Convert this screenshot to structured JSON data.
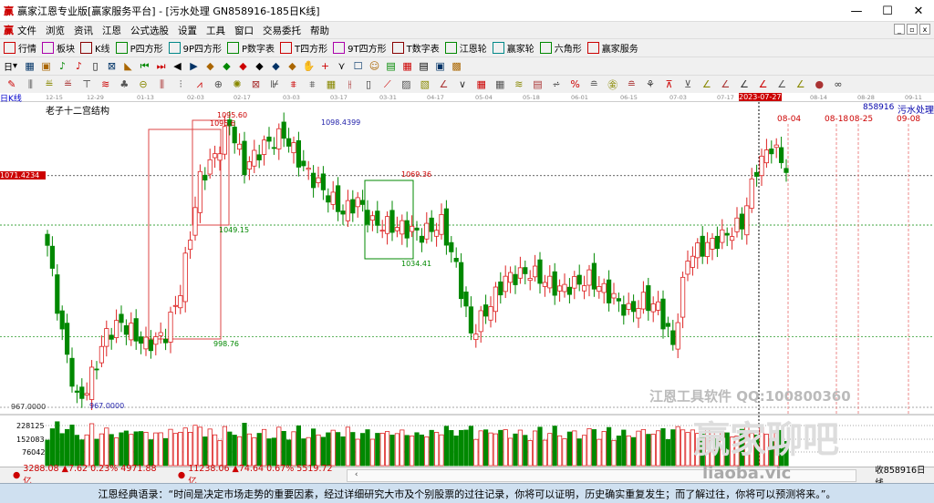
{
  "window": {
    "logo": "赢",
    "title": "赢家江恩专业版[赢家服务平台] - [污水处理  GN858916-185日K线]",
    "min": "—",
    "max": "☐",
    "close": "✕"
  },
  "menu": [
    "文件",
    "浏览",
    "资讯",
    "江恩",
    "公式选股",
    "设置",
    "工具",
    "窗口",
    "交易委托",
    "帮助"
  ],
  "toolbar1": [
    {
      "label": "行情",
      "icon": "grid-icon"
    },
    {
      "label": "板块",
      "icon": "blocks-icon"
    },
    {
      "label": "K线",
      "icon": "kline-icon"
    },
    {
      "label": "P四方形",
      "icon": "P5"
    },
    {
      "label": "9P四方形",
      "icon": "P9"
    },
    {
      "label": "P数字表",
      "icon": "PN"
    },
    {
      "label": "T四方形",
      "icon": "T5"
    },
    {
      "label": "9T四方形",
      "icon": "T9"
    },
    {
      "label": "T数字表",
      "icon": "TN"
    },
    {
      "label": "江恩轮",
      "icon": "wheel-icon"
    },
    {
      "label": "赢家轮",
      "icon": "wheel-icon"
    },
    {
      "label": "六角形",
      "icon": "hexagon-icon"
    },
    {
      "label": "赢家服务",
      "icon": "service-icon"
    }
  ],
  "toolbar2": {
    "period": "日"
  },
  "period_label": "日K线",
  "dates": [
    "12-15",
    "12-29",
    "01-13",
    "02-03",
    "02-17",
    "03-03",
    "03-17",
    "03-31",
    "04-17",
    "05-04",
    "05-18",
    "06-01",
    "06-15",
    "07-03",
    "07-17",
    "2023-07-27",
    "08-14",
    "08-28",
    "09-11"
  ],
  "chart": {
    "title": "老子十二宫结构",
    "stock": "858916",
    "name": "污水处理",
    "price_line": "1071.4234",
    "min_axis": "967.0000",
    "annotations": {
      "high": "1095.60",
      "high2": "1098.4399",
      "low": "967.0000",
      "h1": "1095.6",
      "l1": "1049.15",
      "l2": "998.76",
      "l3": "1034.41",
      "mid": "1069.36"
    },
    "future_dates": [
      "08-04",
      "08-18",
      "08-25",
      "09-08"
    ],
    "volume_ticks": [
      "228125",
      "152083",
      "76042"
    ],
    "watermark1": "江恩工具软件  QQ:100800360",
    "watermark2": "赢家聊吧",
    "watermark3": "liaoba.vic"
  },
  "chart_data": {
    "type": "candlestick",
    "ylim": [
      967,
      1098.44
    ],
    "close_keypoints": [
      [
        0,
        1040
      ],
      [
        3,
        1000
      ],
      [
        6,
        970
      ],
      [
        8,
        975
      ],
      [
        12,
        1000
      ],
      [
        15,
        1005
      ],
      [
        20,
        995
      ],
      [
        24,
        1000
      ],
      [
        27,
        1020
      ],
      [
        31,
        1070
      ],
      [
        34,
        1080
      ],
      [
        37,
        1095
      ],
      [
        40,
        1075
      ],
      [
        44,
        1085
      ],
      [
        48,
        1090
      ],
      [
        52,
        1075
      ],
      [
        56,
        1065
      ],
      [
        60,
        1055
      ],
      [
        63,
        1060
      ],
      [
        66,
        1050
      ],
      [
        72,
        1048
      ],
      [
        76,
        1045
      ],
      [
        80,
        1050
      ],
      [
        83,
        1030
      ],
      [
        86,
        1000
      ],
      [
        89,
        1010
      ],
      [
        93,
        1025
      ],
      [
        98,
        1028
      ],
      [
        104,
        1020
      ],
      [
        110,
        1025
      ],
      [
        114,
        1018
      ],
      [
        118,
        1010
      ],
      [
        121,
        1015
      ],
      [
        124,
        1012
      ],
      [
        127,
        995
      ],
      [
        130,
        1035
      ],
      [
        134,
        1040
      ],
      [
        138,
        1045
      ],
      [
        141,
        1050
      ],
      [
        144,
        1075
      ],
      [
        147,
        1085
      ],
      [
        150,
        1075
      ]
    ],
    "volume_range": [
      0,
      300000
    ]
  },
  "status": {
    "sh": "3288.08 ▲7.62 0.23% 4971.88亿",
    "sz": "11238.06 ▲74.64 0.67% 5519.72亿",
    "right": "收858916日线"
  },
  "quote": "江恩经典语录：“时间是决定市场走势的重要因素，经过详细研究大市及个别股票的过往记录，你将可以证明，历史确实重复发生；而了解过往，你将可以预测将来。”。"
}
